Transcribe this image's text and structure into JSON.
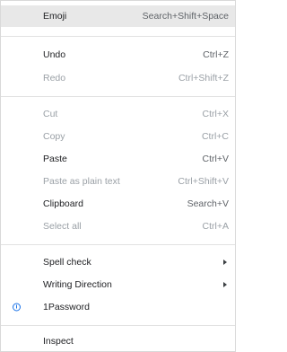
{
  "menu": {
    "emoji": {
      "label": "Emoji",
      "shortcut": "Search+Shift+Space"
    },
    "undo": {
      "label": "Undo",
      "shortcut": "Ctrl+Z"
    },
    "redo": {
      "label": "Redo",
      "shortcut": "Ctrl+Shift+Z"
    },
    "cut": {
      "label": "Cut",
      "shortcut": "Ctrl+X"
    },
    "copy": {
      "label": "Copy",
      "shortcut": "Ctrl+C"
    },
    "paste": {
      "label": "Paste",
      "shortcut": "Ctrl+V"
    },
    "paste_plain": {
      "label": "Paste as plain text",
      "shortcut": "Ctrl+Shift+V"
    },
    "clipboard": {
      "label": "Clipboard",
      "shortcut": "Search+V"
    },
    "select_all": {
      "label": "Select all",
      "shortcut": "Ctrl+A"
    },
    "spell_check": {
      "label": "Spell check"
    },
    "writing_direction": {
      "label": "Writing Direction"
    },
    "onepassword": {
      "label": "1Password",
      "icon": "1password-icon"
    },
    "inspect": {
      "label": "Inspect"
    }
  },
  "colors": {
    "enabled_text": "#202124",
    "disabled_text": "#9aa0a6",
    "highlight_bg": "#e8e8e8",
    "onepassword_blue": "#1a73e8"
  }
}
